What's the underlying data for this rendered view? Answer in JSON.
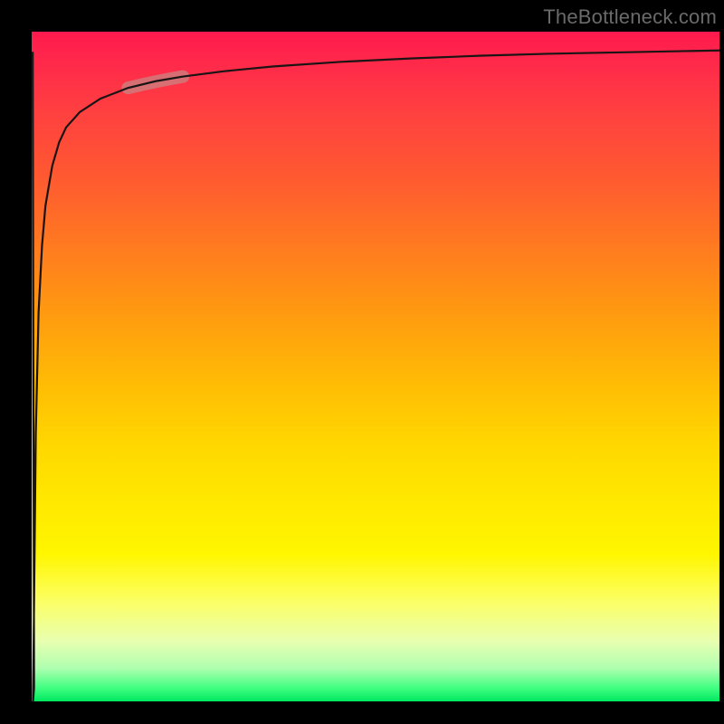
{
  "attribution": "TheBottleneck.com",
  "colors": {
    "background": "#000000",
    "gradient_top": "#ff1a4d",
    "gradient_bottom": "#00e860",
    "curve": "#1a1414",
    "highlight": "#cc8080",
    "attribution_text": "#6a6a6a"
  },
  "chart_data": {
    "type": "line",
    "title": "",
    "xlabel": "",
    "ylabel": "",
    "xlim": [
      0,
      100
    ],
    "ylim": [
      0,
      100
    ],
    "grid": false,
    "legend": false,
    "x": [
      0.2,
      0.6,
      1,
      1.5,
      2,
      3,
      4,
      5,
      7,
      10,
      14,
      18,
      22,
      28,
      35,
      45,
      55,
      65,
      75,
      85,
      95,
      100
    ],
    "values": [
      0,
      40,
      58,
      68,
      74,
      80,
      83.5,
      85.7,
      88,
      90,
      91.6,
      92.6,
      93.3,
      94.1,
      94.8,
      95.5,
      96,
      96.4,
      96.7,
      96.9,
      97.1,
      97.2
    ],
    "highlight_segment": {
      "x_start": 14,
      "x_end": 22,
      "description": "emphasized region on the curve"
    }
  }
}
